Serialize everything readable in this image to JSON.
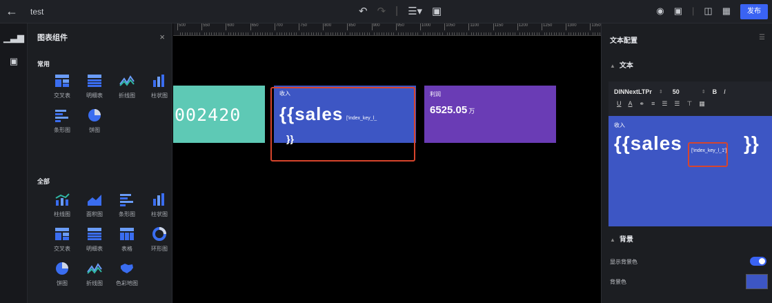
{
  "topbar": {
    "back_icon": "arrow-left-icon",
    "title": "test",
    "publish_label": "发布",
    "accent_color": "#3a63f3"
  },
  "panel": {
    "title": "图表组件",
    "close_glyph": "×",
    "common_label": "常用",
    "all_label": "全部",
    "common_items": [
      {
        "label": "交叉表",
        "icon": "cross-table-icon"
      },
      {
        "label": "明细表",
        "icon": "detail-table-icon"
      },
      {
        "label": "折线图",
        "icon": "line-chart-icon"
      },
      {
        "label": "柱状图",
        "icon": "column-chart-icon"
      },
      {
        "label": "条形图",
        "icon": "bar-chart-icon"
      },
      {
        "label": "饼图",
        "icon": "pie-chart-icon"
      }
    ],
    "all_items": [
      {
        "label": "柱线图",
        "icon": "column-line-chart-icon"
      },
      {
        "label": "面积图",
        "icon": "area-chart-icon"
      },
      {
        "label": "条形图",
        "icon": "bar-chart-icon"
      },
      {
        "label": "柱状图",
        "icon": "column-chart-icon"
      },
      {
        "label": "交叉表",
        "icon": "cross-table-icon"
      },
      {
        "label": "明细表",
        "icon": "detail-table-icon"
      },
      {
        "label": "表格",
        "icon": "table-icon"
      },
      {
        "label": "环形图",
        "icon": "donut-chart-icon"
      },
      {
        "label": "饼图",
        "icon": "pie-chart-icon"
      },
      {
        "label": "折线图",
        "icon": "line-chart-icon"
      },
      {
        "label": "色彩地图",
        "icon": "color-map-icon"
      }
    ]
  },
  "ruler": {
    "ticks": [
      "500",
      "550",
      "600",
      "650",
      "700",
      "750",
      "800",
      "850",
      "900",
      "950",
      "1000",
      "1050",
      "1100",
      "1150",
      "1200",
      "1250",
      "1300",
      "1350"
    ]
  },
  "canvas": {
    "card1": {
      "value": "002420",
      "color": "#5ec9b5"
    },
    "card2": {
      "label": "收入",
      "big": "{{sales",
      "small": "['index_key_l_",
      "tail": "}}",
      "color": "#3d56c4"
    },
    "card3": {
      "label": "利润",
      "value": "6525.05",
      "unit": "万",
      "color": "#6a3cb5"
    },
    "highlight_color": "#d8452c"
  },
  "config": {
    "title": "文本配置",
    "text_section": "文本",
    "font_name": "DINNextLTPr",
    "font_size": "50",
    "bold": "B",
    "italic": "I",
    "preview_label": "收入",
    "preview_big": "{{sales",
    "preview_small": "['index_key_l_1']",
    "preview_close": "}}",
    "background_section": "背景",
    "show_bg_label": "显示背景色",
    "show_bg_on": true,
    "bg_color_label": "背景色",
    "bg_color": "#3d56c4"
  }
}
